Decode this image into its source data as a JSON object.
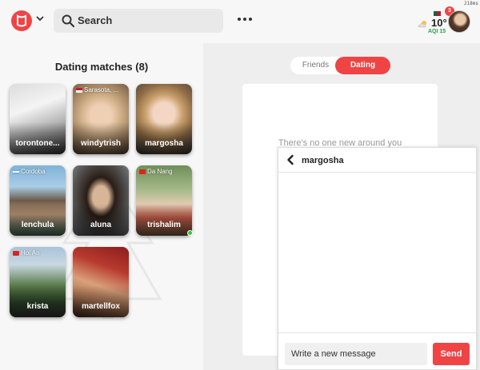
{
  "header": {
    "search_label": "Search",
    "timer": "218ms",
    "weather": {
      "temperature": "10°",
      "aqi": "AQI 15",
      "icon": "partly-cloudy-icon"
    },
    "notification_count": "3"
  },
  "matches": {
    "title": "Dating matches (8)",
    "items": [
      {
        "name": "torontone...",
        "location": ""
      },
      {
        "name": "windytrish",
        "location": "Sarasota, ..."
      },
      {
        "name": "margosha",
        "location": ""
      },
      {
        "name": "lenchula",
        "location": "Cordoba"
      },
      {
        "name": "aluna",
        "location": ""
      },
      {
        "name": "trishalim",
        "location": "Da Nang"
      },
      {
        "name": "krista",
        "location": "Hoi An"
      },
      {
        "name": "martellfox",
        "location": ""
      }
    ]
  },
  "toggle": {
    "friends": "Friends",
    "dating": "Dating"
  },
  "discover": {
    "empty_text": "There's no one new around you"
  },
  "chat": {
    "name": "margosha",
    "input_placeholder": "Write a new message",
    "send_label": "Send"
  },
  "colors": {
    "accent": "#ef4444",
    "aqi_good": "#22a447",
    "online": "#3cc13b"
  }
}
